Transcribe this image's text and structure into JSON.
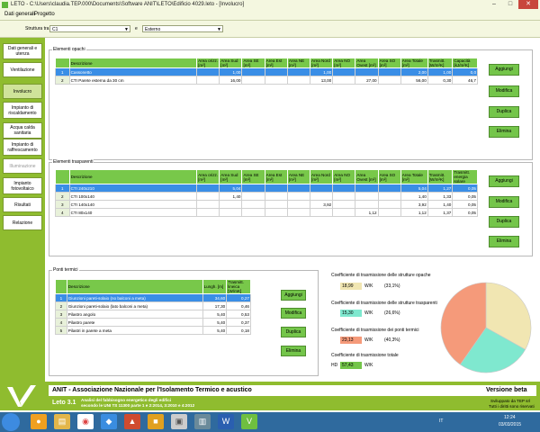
{
  "window": {
    "title": "LETO - C:\\Users\\claudia.TEP.000\\Documents\\Software ANIT\\LETO\\Edificio 4029.leto - [Involucro]",
    "controls": {
      "minimize": "–",
      "maximize": "□",
      "close": "✕"
    }
  },
  "menu": {
    "items": [
      "Dati generali",
      "Progetto"
    ]
  },
  "toolbar": {
    "struttura_label": "Struttura tra",
    "struttura_value": "C1",
    "tra_label": "e",
    "tra_value": "Esterno"
  },
  "sidebar": {
    "items": [
      {
        "label": "Dati generali e utenza"
      },
      {
        "label": "Ventilazione"
      },
      {
        "label": "Involucro"
      },
      {
        "label": "Impianto di riscaldamento"
      },
      {
        "label": "Acqua calda sanitaria"
      },
      {
        "label": "Impianto di raffrescamento"
      },
      {
        "label": "Illuminazione"
      },
      {
        "label": "Impianto fotovoltaico"
      },
      {
        "label": "Risultati"
      },
      {
        "label": "Relazione"
      }
    ]
  },
  "opachi": {
    "title": "Elementi opachi",
    "headers": [
      "Descrizione",
      "Area orizz. [m²]",
      "Area Sud [m²]",
      "Area SE [m²]",
      "Area Est [m²]",
      "Area NE [m²]",
      "Area Nord [m²]",
      "Area NO [m²]",
      "Area Ovest [m²]",
      "Area SO [m²]",
      "Area Totale [m²]",
      "Trasmitt. [W/m²K]",
      "Capacità [kJ/m²K]"
    ],
    "rows": [
      {
        "n": "1",
        "cells": [
          "Cassonetto",
          "",
          "1,00",
          "",
          "",
          "",
          "1,00",
          "",
          "",
          "",
          "2,00",
          "1,00",
          "0,0"
        ]
      },
      {
        "n": "2",
        "cells": [
          "CTI Parete esterna da 30 cm",
          "",
          "16,00",
          "",
          "",
          "",
          "13,00",
          "",
          "27,00",
          "",
          "56,00",
          "0,30",
          "46,7"
        ]
      }
    ]
  },
  "trasparenti": {
    "title": "Elementi trasparenti",
    "headers": [
      "Descrizione",
      "Area orizz. [m²]",
      "Area Sud [m²]",
      "Area SE [m²]",
      "Area Est [m²]",
      "Area NE [m²]",
      "Area Nord [m²]",
      "Area NO [m²]",
      "Area Ovest [m²]",
      "Area SO [m²]",
      "Area Totale [m²]",
      "Trasmitt. [W/m²K]",
      "Trasmitt. energia solare"
    ],
    "rows": [
      {
        "n": "1",
        "cells": [
          "CTI 240x210",
          "",
          "5,04",
          "",
          "",
          "",
          "",
          "",
          "",
          "",
          "5,04",
          "1,27",
          "0,05"
        ]
      },
      {
        "n": "2",
        "cells": [
          "CTI 100x140",
          "",
          "1,40",
          "",
          "",
          "",
          "",
          "",
          "",
          "",
          "1,40",
          "1,33",
          "0,05"
        ]
      },
      {
        "n": "3",
        "cells": [
          "CTI 140x140",
          "",
          "",
          "",
          "",
          "",
          "3,92",
          "",
          "",
          "",
          "3,92",
          "1,40",
          "0,05"
        ]
      },
      {
        "n": "4",
        "cells": [
          "CTI 80x140",
          "",
          "",
          "",
          "",
          "",
          "",
          "",
          "1,12",
          "",
          "1,12",
          "1,37",
          "0,05"
        ]
      }
    ]
  },
  "ponti": {
    "title": "Ponti termici",
    "headers": [
      "Descrizione",
      "Lungh. [m]",
      "Trasmitt. lineica [W/mK]"
    ],
    "rows": [
      {
        "n": "1",
        "cells": [
          "Giunzioni pareti-solaio (no balconi a meta)",
          "34,60",
          "0,27"
        ]
      },
      {
        "n": "2",
        "cells": [
          "Giunzioni pareti-solaio (lato balconi a meta)",
          "17,30",
          "0,46"
        ]
      },
      {
        "n": "3",
        "cells": [
          "Pilastro angolo",
          "5,40",
          "0,53"
        ]
      },
      {
        "n": "4",
        "cells": [
          "Pilastro parete",
          "5,40",
          "0,37"
        ]
      },
      {
        "n": "5",
        "cells": [
          "Pilastri in parete a meta",
          "5,40",
          "0,18"
        ]
      }
    ]
  },
  "buttons": {
    "add": "Aggiungi",
    "edit": "Modifica",
    "dup": "Duplica",
    "del": "Elimina"
  },
  "coefficients": {
    "opache": {
      "label": "Coefficiente di trasmissione delle strutture opache",
      "value": "18,99",
      "unit": "W/K",
      "pct": "(33,1%)",
      "color": "#f1e6b2"
    },
    "trasparenti": {
      "label": "Coefficiente di trasmissione delle strutture trasparenti",
      "value": "15,30",
      "unit": "W/K",
      "pct": "(26,6%)",
      "color": "#7fe8cf"
    },
    "ponti": {
      "label": "Coefficiente di trasmissione dei ponti termici",
      "value": "23,13",
      "unit": "W/K",
      "pct": "(40,3%)",
      "color": "#f59a7a"
    },
    "totale": {
      "label": "Coefficiente di trasmissione totale",
      "prefix": "HD",
      "value": "57,43",
      "unit": "W/K",
      "color": "#74c54a"
    }
  },
  "chart_data": {
    "type": "pie",
    "categories": [
      "Strutture opache",
      "Strutture trasparenti",
      "Ponti termici"
    ],
    "values": [
      33.1,
      26.6,
      40.3
    ],
    "colors": [
      "#f1e6b2",
      "#7fe8cf",
      "#f59a7a"
    ]
  },
  "footer": {
    "org": "ANIT - Associazione Nazionale per l'Isolamento Termico e acustico",
    "version": "Versione beta",
    "product": "Leto 3.1",
    "subtitle1": "Analisi del fabbisogno energetico degli edifici",
    "subtitle2": "secondo le UNI TS 11300 parte 1 e 2:2014, 3:2010 e 4:2012",
    "credit1": "Sviluppato da TEP srl",
    "credit2": "Tutti i diritti sono riservati"
  },
  "taskbar": {
    "lang": "IT",
    "time": "12:24",
    "date": "03/03/2015"
  }
}
